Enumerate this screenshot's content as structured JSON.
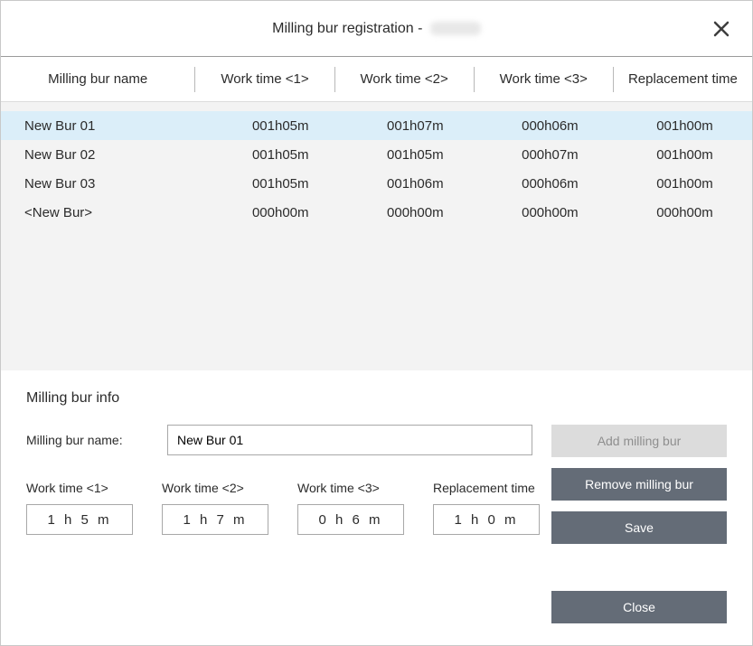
{
  "title": "Milling bur registration - ",
  "columns": [
    "Milling bur name",
    "Work time <1>",
    "Work time <2>",
    "Work time <3>",
    "Replacement time"
  ],
  "rows": [
    {
      "name": "New Bur 01",
      "wt1": "001h05m",
      "wt2": "001h07m",
      "wt3": "000h06m",
      "rep": "001h00m",
      "selected": true
    },
    {
      "name": "New Bur 02",
      "wt1": "001h05m",
      "wt2": "001h05m",
      "wt3": "000h07m",
      "rep": "001h00m",
      "selected": false
    },
    {
      "name": "New Bur 03",
      "wt1": "001h05m",
      "wt2": "001h06m",
      "wt3": "000h06m",
      "rep": "001h00m",
      "selected": false
    },
    {
      "name": "<New Bur>",
      "wt1": "000h00m",
      "wt2": "000h00m",
      "wt3": "000h00m",
      "rep": "000h00m",
      "selected": false
    }
  ],
  "info_title": "Milling bur info",
  "name_label": "Milling bur name:",
  "name_value": "New Bur 01",
  "wt_labels": [
    "Work time <1>",
    "Work time <2>",
    "Work time <3>",
    "Replacement time"
  ],
  "wt_values": [
    "1 h 5 m",
    "1 h 7 m",
    "0 h 6 m",
    "1 h 0 m"
  ],
  "buttons": {
    "add": "Add milling bur",
    "remove": "Remove milling bur",
    "save": "Save",
    "close": "Close"
  }
}
